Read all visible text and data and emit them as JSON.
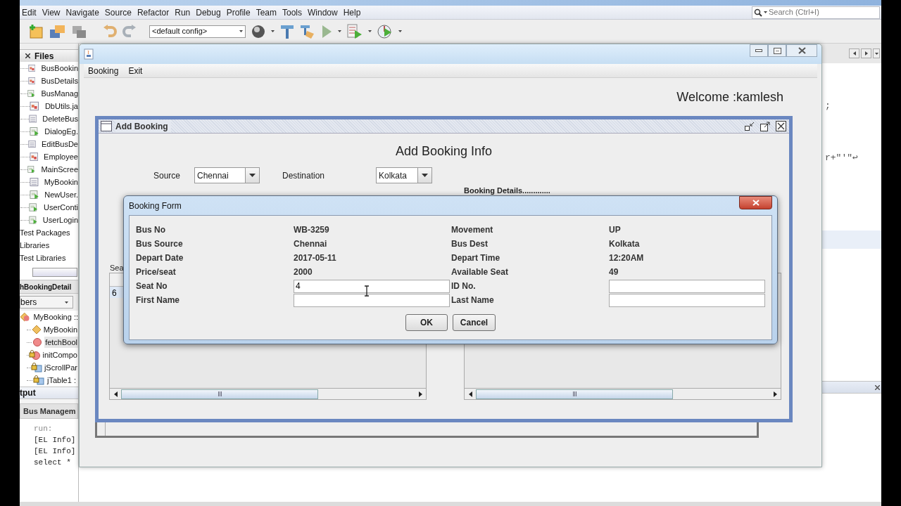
{
  "ide": {
    "menu": [
      "Edit",
      "View",
      "Navigate",
      "Source",
      "Refactor",
      "Run",
      "Debug",
      "Profile",
      "Team",
      "Tools",
      "Window",
      "Help"
    ],
    "config": "<default config>",
    "search": {
      "placeholder": "Search (Ctrl+I)"
    },
    "projects": {
      "tab": "Files",
      "files": [
        {
          "label": "BusBookin",
          "kind": "form"
        },
        {
          "label": "BusDetails",
          "kind": "form"
        },
        {
          "label": "BusManag",
          "kind": "runnable"
        },
        {
          "label": "DbUtils.ja",
          "kind": "form"
        },
        {
          "label": "DeleteBus",
          "kind": "plain"
        },
        {
          "label": "DialogEg.",
          "kind": "runnable"
        },
        {
          "label": "EditBusDe",
          "kind": "plain"
        },
        {
          "label": "Employee",
          "kind": "form"
        },
        {
          "label": "MainScree",
          "kind": "runnable"
        },
        {
          "label": "MyBookin",
          "kind": "plain"
        },
        {
          "label": "NewUser.",
          "kind": "runnable"
        },
        {
          "label": "UserConti",
          "kind": "runnable"
        },
        {
          "label": "UserLogin",
          "kind": "runnable"
        }
      ],
      "nodes": [
        "Test Packages",
        "Libraries",
        "Test Libraries"
      ]
    },
    "navigator": {
      "title": "hBookingDetail",
      "filter": "bers",
      "members": [
        {
          "label": "MyBooking ::",
          "kind": "class",
          "children": [
            {
              "label": "MyBookin",
              "kind": "constructor",
              "selected": false
            },
            {
              "label": "fetchBool",
              "kind": "method",
              "selected": true
            },
            {
              "label": "initCompo",
              "kind": "private-method",
              "selected": false
            },
            {
              "label": "jScrollPar",
              "kind": "private-field",
              "selected": false
            },
            {
              "label": "jTable1 :",
              "kind": "private-field",
              "selected": false
            }
          ]
        }
      ]
    },
    "output": {
      "title": "tput",
      "tab": "Bus Managem",
      "lines": [
        "run:",
        "[EL Info]",
        "[EL Info]",
        "select *"
      ]
    },
    "editor": {
      "lines": [
        ";",
        "r+\"'\"↩"
      ]
    }
  },
  "app": {
    "menu": [
      "Booking",
      "Exit"
    ],
    "welcome": "Welcome :kamlesh",
    "frame": {
      "title": "Add Booking",
      "heading": "Add Booking Info",
      "source": {
        "label": "Source",
        "value": "Chennai"
      },
      "destination": {
        "label": "Destination",
        "value": "Kolkata"
      },
      "details_label": "Booking Details.............",
      "search_label": "Sea",
      "left_table": {
        "rows": [
          [
            "6"
          ]
        ]
      }
    },
    "dialog": {
      "title": "Booking Form",
      "fields": [
        {
          "label": "Bus No",
          "value": "WB-3259",
          "kind": "text"
        },
        {
          "label": "Movement",
          "value": "UP",
          "kind": "text"
        },
        {
          "label": "Bus Source",
          "value": "Chennai",
          "kind": "text"
        },
        {
          "label": "Bus Dest",
          "value": "Kolkata",
          "kind": "text"
        },
        {
          "label": "Depart Date",
          "value": "2017-05-11",
          "kind": "text"
        },
        {
          "label": "Depart Time",
          "value": "12:20AM",
          "kind": "text"
        },
        {
          "label": "Price/seat",
          "value": "2000",
          "kind": "text"
        },
        {
          "label": "Available Seat",
          "value": "49",
          "kind": "text"
        },
        {
          "label": "Seat No",
          "value": "4",
          "kind": "input"
        },
        {
          "label": "ID No.",
          "kind": "input"
        },
        {
          "label": "First Name",
          "kind": "input"
        },
        {
          "label": "Last Name",
          "kind": "input"
        }
      ],
      "buttons": [
        "OK",
        "Cancel"
      ]
    }
  }
}
